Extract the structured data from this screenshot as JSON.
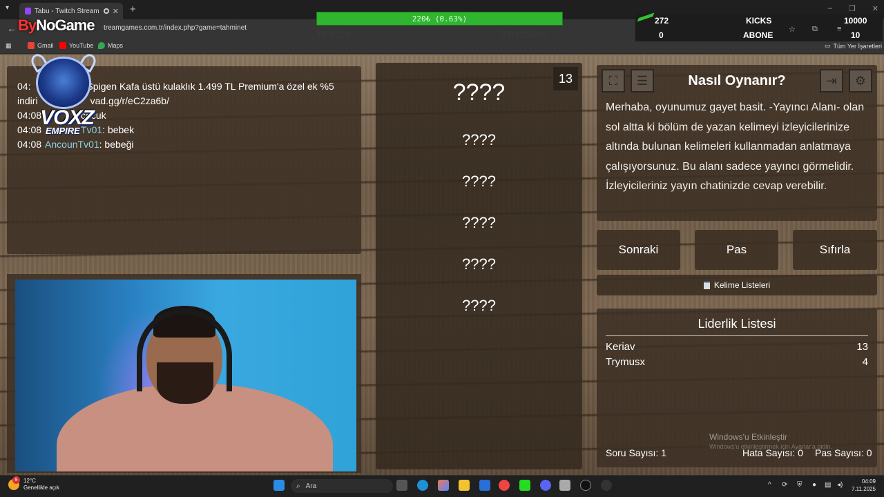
{
  "browser": {
    "tab_title": "Tabu - Twitch Stream Game",
    "url": "treamgames.com.tr/index.php?game=tahminet",
    "bookmarks": [
      {
        "label": "Gmail",
        "color": "#ea4335"
      },
      {
        "label": "YouTube",
        "color": "#ff0000"
      },
      {
        "label": "Maps",
        "color": "#34a853"
      }
    ],
    "all_bookmarks": "Tüm Yer İşaretleri"
  },
  "overlay": {
    "logo": {
      "by": "By",
      "rest": "NoGame"
    },
    "goal_text": "220₺ (0.63%)",
    "ghost_left": "TPY110",
    "ghost_right": "TPY35000",
    "stats": {
      "row1_value": "272",
      "row1_label": "KICKS",
      "row1_goal": "10000",
      "row2_value": "0",
      "row2_label": "ABONE",
      "row2_goal": "10"
    },
    "badge": {
      "line1": "VOXZ",
      "line2": "EMPIRE"
    }
  },
  "chat": [
    {
      "time": "04:",
      "user": "",
      "text": "Spigen Kafa üstü kulaklık 1.499 TL Premium'a özel ek %5"
    },
    {
      "time": "indiri",
      "user": "",
      "text": "vad.gg/r/eC2za6b/"
    },
    {
      "time": "04:08",
      "user": "",
      "text": "çocuk"
    },
    {
      "time": "04:08",
      "user": "Tv01",
      "text": ": bebek"
    },
    {
      "time": "04:08",
      "user": "AncounTv01",
      "text": ": bebeği"
    }
  ],
  "game": {
    "counter": "13",
    "main_word": "????",
    "taboo_words": [
      "????",
      "????",
      "????",
      "????",
      "????"
    ]
  },
  "howto": {
    "title": "Nasıl Oynanır?",
    "text": "Merhaba, oyunumuz gayet basit. -Yayıncı Alanı- olan sol altta ki bölüm de yazan kelimeyi izleyicilerinize altında bulunan kelimeleri kullanmadan anlatmaya çalışıyorsunuz. Bu alanı sadece yayıncı görmelidir. İzleyicileriniz yayın chatinizde cevap verebilir."
  },
  "buttons": {
    "next": "Sonraki",
    "pass": "Pas",
    "reset": "Sıfırla",
    "word_lists": "Kelime Listeleri"
  },
  "leaderboard": {
    "title": "Liderlik Listesi",
    "rows": [
      {
        "name": "Keriav",
        "score": "13"
      },
      {
        "name": "Trymusx",
        "score": "4"
      }
    ],
    "question_count": "Soru Sayısı: 1",
    "error_count": "Hata Sayısı: 0",
    "pass_count": "Pas Sayısı: 0"
  },
  "watermark": {
    "line1": "Windows'u Etkinleştir",
    "line2": "Windows'u etkinleştirmek için Ayarlar'a gidin."
  },
  "taskbar": {
    "weather_temp": "12°C",
    "weather_desc": "Genellikle açık",
    "weather_badge": "9",
    "search": "Ara",
    "time": "04:09",
    "date": "7.11.2025"
  }
}
